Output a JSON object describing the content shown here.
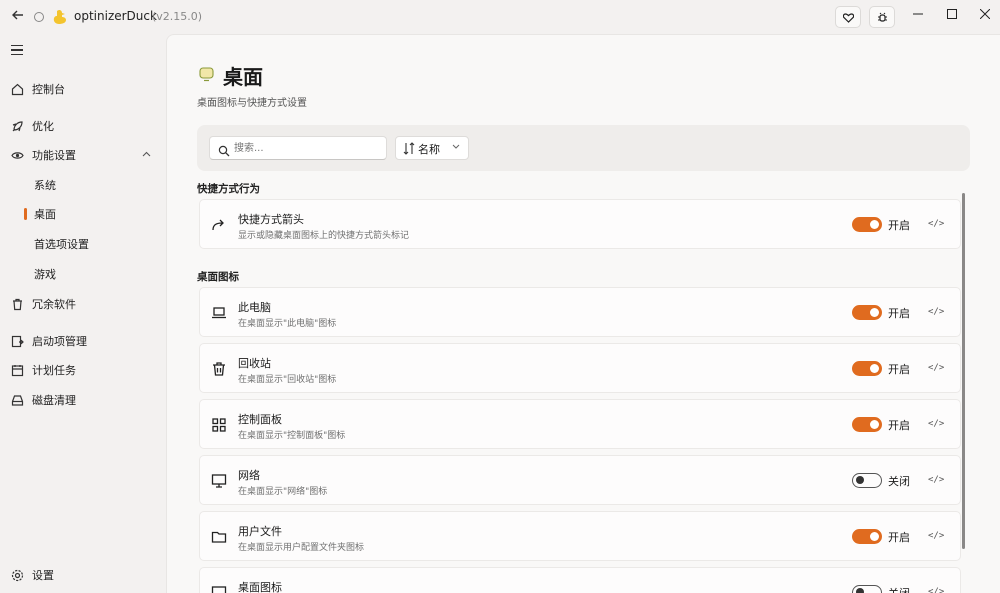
{
  "app": {
    "title": "optinizerDuck",
    "version": "(v2.15.0)"
  },
  "sidebar": {
    "items": [
      {
        "label": "控制台",
        "icon": "home-icon"
      },
      {
        "label": "优化",
        "icon": "rocket-icon"
      },
      {
        "label": "功能设置",
        "icon": "eye-icon",
        "expanded": true
      },
      {
        "label": "冗余软件",
        "icon": "trash-icon"
      },
      {
        "label": "启动项管理",
        "icon": "startup-icon"
      },
      {
        "label": "计划任务",
        "icon": "calendar-icon"
      },
      {
        "label": "磁盘清理",
        "icon": "disk-icon"
      }
    ],
    "sub_items": [
      {
        "label": "系统"
      },
      {
        "label": "桌面",
        "selected": true
      },
      {
        "label": "首选项设置"
      },
      {
        "label": "游戏"
      }
    ],
    "settings_label": "设置"
  },
  "page": {
    "title": "桌面",
    "subtitle": "桌面图标与快捷方式设置"
  },
  "toolbar": {
    "search_placeholder": "搜索...",
    "sort_label": "名称"
  },
  "sections": {
    "shortcut_label": "快捷方式行为",
    "desktop_label": "桌面图标"
  },
  "shortcut_cards": [
    {
      "title": "快捷方式箭头",
      "desc": "显示或隐藏桌面图标上的快捷方式箭头标记",
      "state": "开启",
      "on": true,
      "icon": "redo-arrow-icon"
    }
  ],
  "desktop_cards": [
    {
      "title": "此电脑",
      "desc": "在桌面显示\"此电脑\"图标",
      "state": "开启",
      "on": true,
      "icon": "laptop-icon"
    },
    {
      "title": "回收站",
      "desc": "在桌面显示\"回收站\"图标",
      "state": "开启",
      "on": true,
      "icon": "recycle-bin-icon"
    },
    {
      "title": "控制面板",
      "desc": "在桌面显示\"控制面板\"图标",
      "state": "开启",
      "on": true,
      "icon": "grid-icon"
    },
    {
      "title": "网络",
      "desc": "在桌面显示\"网络\"图标",
      "state": "关闭",
      "on": false,
      "icon": "monitor-icon"
    },
    {
      "title": "用户文件",
      "desc": "在桌面显示用户配置文件夹图标",
      "state": "开启",
      "on": true,
      "icon": "folder-icon"
    },
    {
      "title": "桌面图标",
      "desc": "",
      "state": "关闭",
      "on": false,
      "icon": "desktop-icon"
    }
  ],
  "colors": {
    "accent": "#e06b1f",
    "background": "#f3f1f0",
    "content": "#f9f8f7"
  }
}
